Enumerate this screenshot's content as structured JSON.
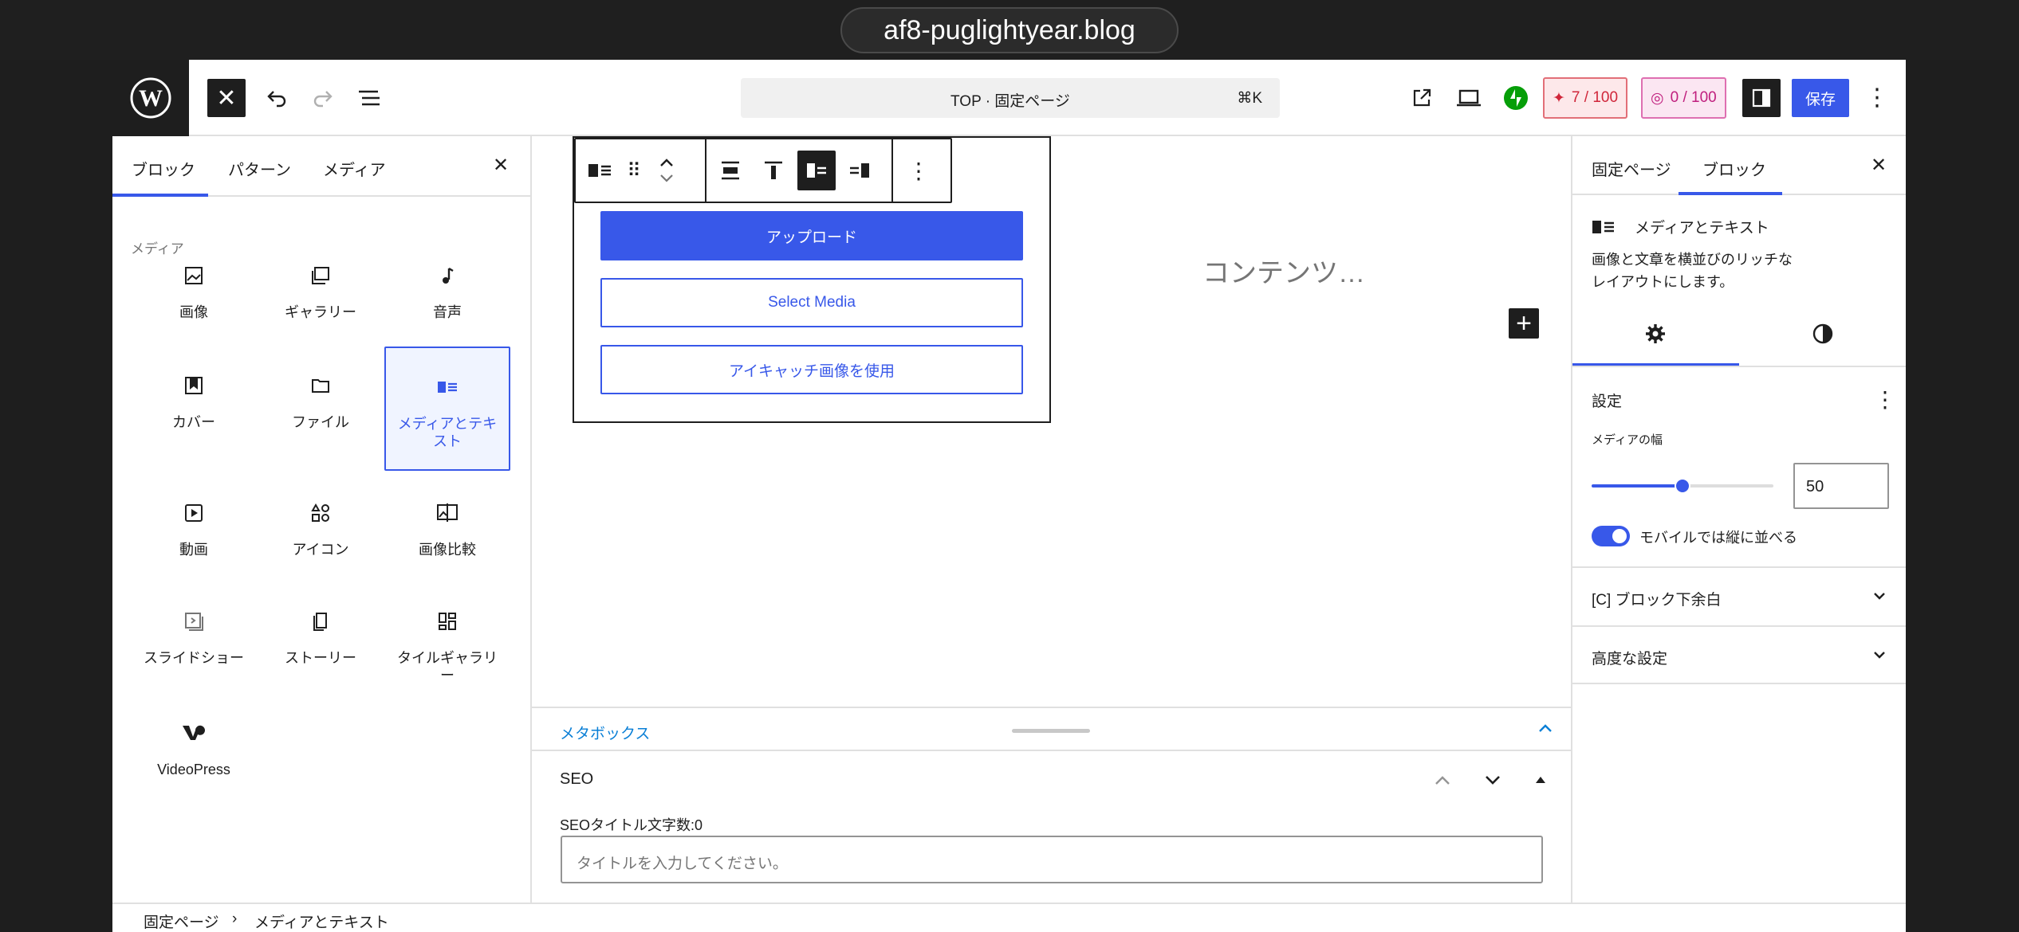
{
  "browser": {
    "url": "af8-puglightyear.blog"
  },
  "header": {
    "command": "TOP · 固定ページ",
    "shortcut": "⌘K",
    "badge1": "7 / 100",
    "badge2": "0 / 100",
    "save": "保存"
  },
  "inserter": {
    "tabs": [
      "ブロック",
      "パターン",
      "メディア"
    ],
    "section": "メディア",
    "blocks": [
      {
        "label": "画像",
        "icon": "image-icon"
      },
      {
        "label": "ギャラリー",
        "icon": "gallery-icon"
      },
      {
        "label": "音声",
        "icon": "audio-icon"
      },
      {
        "label": "カバー",
        "icon": "cover-icon"
      },
      {
        "label": "ファイル",
        "icon": "file-icon"
      },
      {
        "label": "メディアとテキスト",
        "icon": "media-text-icon"
      },
      {
        "label": "動画",
        "icon": "video-icon"
      },
      {
        "label": "アイコン",
        "icon": "icons-icon"
      },
      {
        "label": "画像比較",
        "icon": "image-compare-icon"
      },
      {
        "label": "スライドショー",
        "icon": "slideshow-icon"
      },
      {
        "label": "ストーリー",
        "icon": "story-icon"
      },
      {
        "label": "タイルギャラリー",
        "icon": "tiled-gallery-icon"
      },
      {
        "label": "VideoPress",
        "icon": "videopress-icon"
      }
    ]
  },
  "canvas": {
    "upload": "アップロード",
    "select_media": "Select Media",
    "featured": "アイキャッチ画像を使用",
    "content_placeholder": "コンテンツ…"
  },
  "metabox": {
    "label": "メタボックス",
    "seo_title": "SEO",
    "seo_count": "SEOタイトル文字数:0",
    "seo_placeholder": "タイトルを入力してください。"
  },
  "sidebar": {
    "tabs": [
      "固定ページ",
      "ブロック"
    ],
    "block_title": "メディアとテキスト",
    "block_desc": "画像と文章を横並びのリッチなレイアウトにします。",
    "settings": "設定",
    "media_width_label": "メディアの幅",
    "media_width": "50",
    "media_width_value": 50,
    "stack_mobile": "モバイルでは縦に並べる",
    "panel1": "[C] ブロック下余白",
    "panel2": "高度な設定"
  },
  "footer": {
    "crumb1": "固定ページ",
    "crumb2": "メディアとテキスト"
  },
  "colors": {
    "accent": "#3858e9",
    "dark": "#1e1e1e"
  }
}
